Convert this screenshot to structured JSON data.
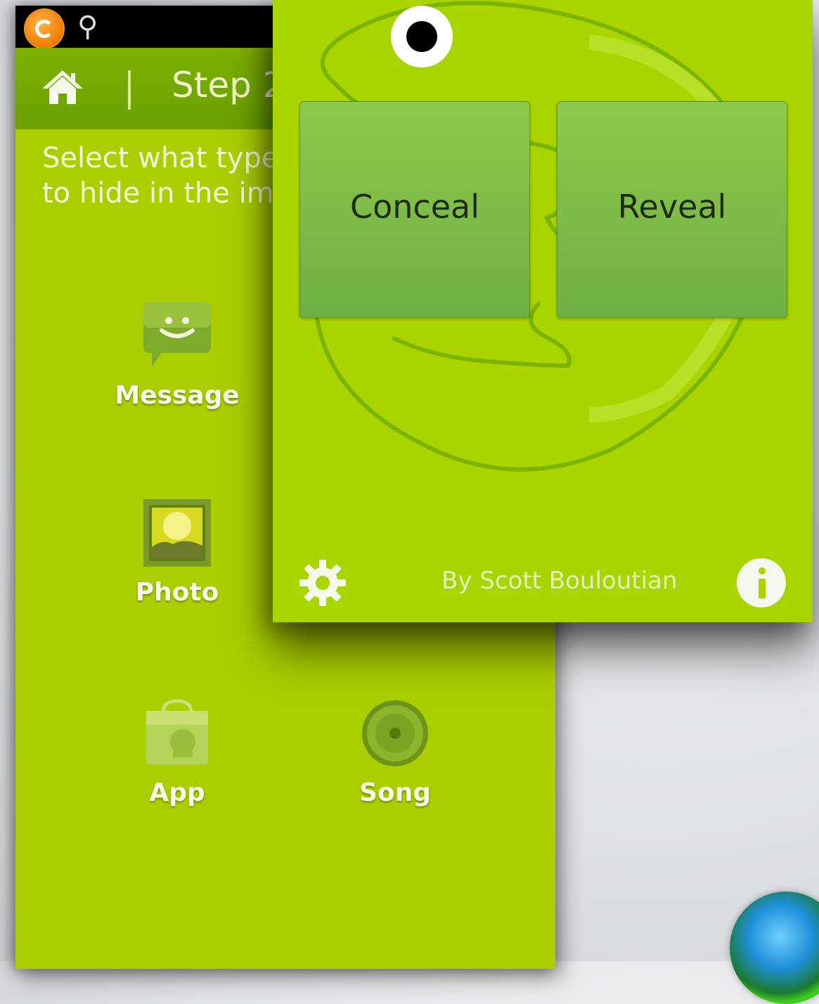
{
  "back_screen": {
    "title": "Step 2",
    "instructions": "Select what type of item\nto hide in the image",
    "types": [
      {
        "label": "Message",
        "icon": "message-icon"
      },
      {
        "label": "Photo",
        "icon": "photo-icon"
      },
      {
        "label": "App",
        "icon": "app-icon"
      },
      {
        "label": "Song",
        "icon": "song-icon"
      }
    ],
    "colors": {
      "background": "#a9cf00",
      "action_bar": "#6aa000"
    }
  },
  "dialog": {
    "conceal_label": "Conceal",
    "reveal_label": "Reveal",
    "credit": "By Scott Bouloutian",
    "colors": {
      "background": "#a9d400",
      "button": "#7dbd47"
    }
  },
  "icons": [
    "notification-icon",
    "usb-icon",
    "home-icon",
    "gear-icon",
    "info-icon"
  ]
}
